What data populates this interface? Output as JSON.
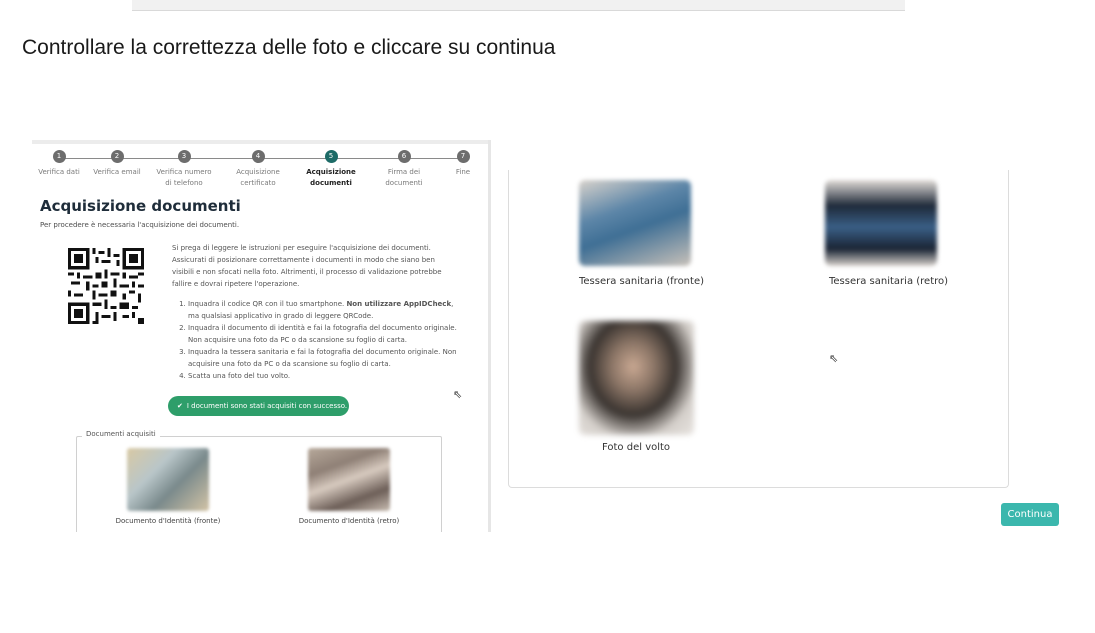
{
  "heading": "Controllare la correttezza delle foto e cliccare su continua",
  "left_panel": {
    "steps": [
      {
        "num": "1",
        "label": "Verifica dati"
      },
      {
        "num": "2",
        "label": "Verifica email"
      },
      {
        "num": "3",
        "label": "Verifica numero\ndi telefono"
      },
      {
        "num": "4",
        "label": "Acquisizione\ncertificato"
      },
      {
        "num": "5",
        "label": "Acquisizione\ndocumenti"
      },
      {
        "num": "6",
        "label": "Firma dei\ndocumenti"
      },
      {
        "num": "7",
        "label": "Fine"
      }
    ],
    "active_step": 5,
    "title": "Acquisizione documenti",
    "subtitle": "Per procedere è necessaria l'acquisizione dei documenti.",
    "intro": "Si prega di leggere le istruzioni per eseguire l'acquisizione dei documenti. Assicurati di posizionare correttamente i documenti in modo che siano ben visibili e non sfocati nella foto. Altrimenti, il processo di validazione potrebbe fallire e dovrai ripetere l'operazione.",
    "instructions": [
      {
        "pre": "Inquadra il codice QR con il tuo smartphone. ",
        "bold": "Non utilizzare AppIDCheck",
        "post": ", ma qualsiasi applicativo in grado di leggere QRCode."
      },
      {
        "pre": "Inquadra il documento di identità e fai la fotografia del documento originale. Non acquisire una foto da PC o da scansione su foglio di carta.",
        "bold": "",
        "post": ""
      },
      {
        "pre": "Inquadra la tessera sanitaria e fai la fotografia del documento originale. Non acquisire una foto da PC o da scansione su foglio di carta.",
        "bold": "",
        "post": ""
      },
      {
        "pre": "Scatta una foto del tuo volto.",
        "bold": "",
        "post": ""
      }
    ],
    "success_message": "I documenti sono stati acquisiti con successo.",
    "acquired_legend": "Documenti acquisiti",
    "acquired_docs": [
      "Documento d'Identità (fronte)",
      "Documento d'Identità (retro)"
    ]
  },
  "right_panel": {
    "photos": [
      "Tessera sanitaria (fronte)",
      "Tessera sanitaria (retro)",
      "Foto del volto"
    ]
  },
  "continue_button": "Continua",
  "colors": {
    "active_step": "#1d6b67",
    "success": "#2e9e6a",
    "button": "#3bb7ad"
  }
}
